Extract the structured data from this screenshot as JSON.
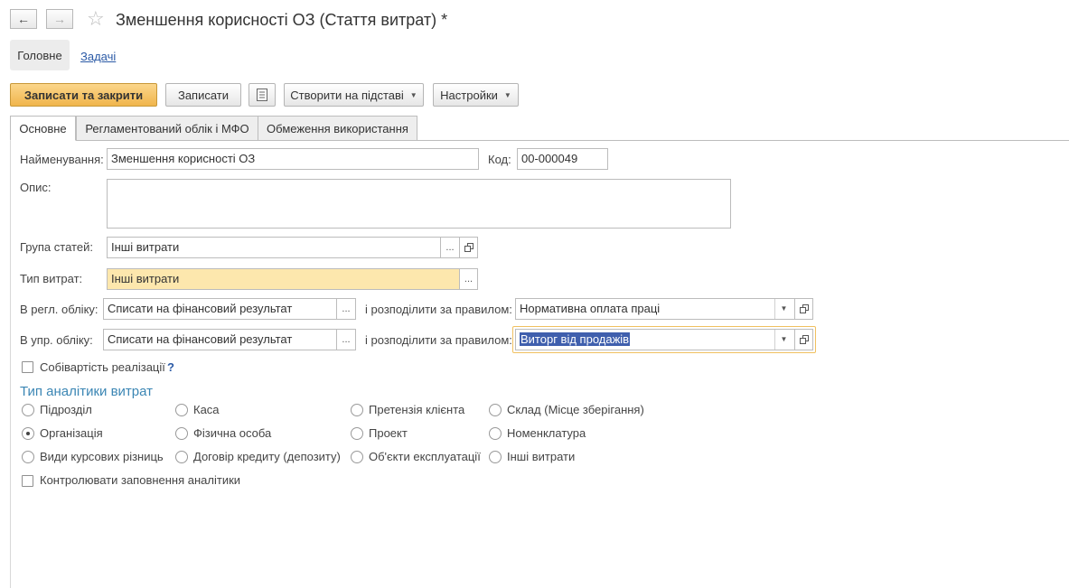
{
  "window": {
    "title": "Зменшення корисності ОЗ (Стаття витрат) *"
  },
  "nav": {
    "main_tab": "Головне",
    "tasks_link": "Задачі"
  },
  "toolbar": {
    "save_close": "Записати та закрити",
    "save": "Записати",
    "create_based": "Створити на підставі",
    "settings": "Настройки"
  },
  "tabs": [
    {
      "label": "Основне"
    },
    {
      "label": "Регламентований облік і МФО"
    },
    {
      "label": "Обмеження використання"
    }
  ],
  "form": {
    "name_label": "Найменування:",
    "name_value": "Зменшення корисності ОЗ",
    "code_label": "Код:",
    "code_value": "00-000049",
    "desc_label": "Опис:",
    "desc_value": "",
    "group_label": "Група статей:",
    "group_value": "Інші витрати",
    "type_label": "Тип витрат:",
    "type_value": "Інші витрати",
    "reg_label": "В регл. обліку:",
    "reg_value": "Списати на фінансовий результат",
    "reg_rule_label": "і розподілити за правилом:",
    "reg_rule_value": "Нормативна оплата праці",
    "mgmt_label": "В упр. обліку:",
    "mgmt_value": "Списати на фінансовий результат",
    "mgmt_rule_label": "і розподілити за правилом:",
    "mgmt_rule_value": "Виторг від продажів",
    "cost_label": "Собівартість реалізації",
    "cost_help": "?",
    "cost_checked": false
  },
  "analytics": {
    "title": "Тип аналітики витрат",
    "options": [
      {
        "label": "Підрозділ",
        "selected": false
      },
      {
        "label": "Каса",
        "selected": false
      },
      {
        "label": "Претензія клієнта",
        "selected": false
      },
      {
        "label": "Склад (Місце зберігання)",
        "selected": false
      },
      {
        "label": "Організація",
        "selected": true
      },
      {
        "label": "Фізична особа",
        "selected": false
      },
      {
        "label": "Проект",
        "selected": false
      },
      {
        "label": "Номенклатура",
        "selected": false
      },
      {
        "label": "Види курсових різниць",
        "selected": false
      },
      {
        "label": "Договір кредиту (депозиту)",
        "selected": false
      },
      {
        "label": "Об'єкти експлуатації",
        "selected": false
      },
      {
        "label": "Інші витрати",
        "selected": false
      }
    ],
    "control_label": "Контролювати заповнення аналітики",
    "control_checked": false
  },
  "icons": {
    "back": "arrow-left-icon",
    "forward": "arrow-right-icon",
    "favorite": "star-icon",
    "list": "list-icon",
    "open": "open-window-icon",
    "select": "ellipsis-icon",
    "dropdown": "chevron-down-icon"
  }
}
